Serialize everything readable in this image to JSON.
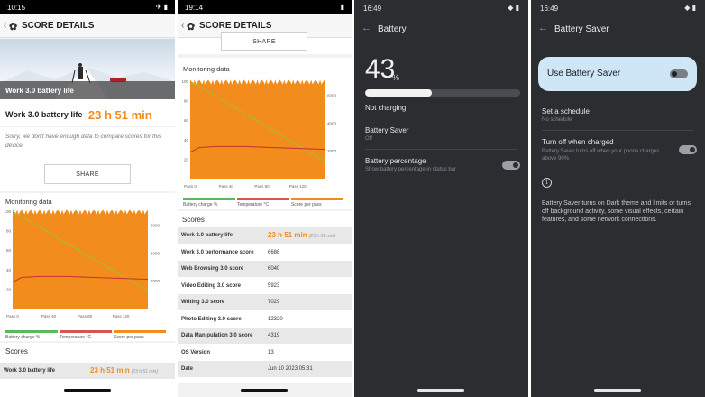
{
  "phone1": {
    "status": {
      "time": "10:15",
      "icons": "✈ ▮"
    },
    "header_title": "SCORE DETAILS",
    "hero_caption": "Work 3.0 battery life",
    "life_label": "Work 3.0 battery life",
    "life_value": "23 h 51 min",
    "sorry_text": "Sorry, we don't have enough data to compare scores for this device.",
    "share_label": "SHARE",
    "monitoring_title": "Monitoring data",
    "scores_title": "Scores",
    "first_score": {
      "label": "Work 3.0 battery life",
      "value": "23 h 51 min",
      "sub": "(23 h 51 min)"
    }
  },
  "phone2": {
    "status": {
      "time": "19:14",
      "icons": "▮"
    },
    "header_title": "SCORE DETAILS",
    "share_label": "SHARE",
    "monitoring_title": "Monitoring data",
    "scores_title": "Scores",
    "scores": [
      {
        "label": "Work 3.0 battery life",
        "value": "23 h 51 min",
        "sub": "(23 h 51 min)"
      },
      {
        "label": "Work 3.0 performance score",
        "value": "6688"
      },
      {
        "label": "Web Browsing 3.0 score",
        "value": "6040"
      },
      {
        "label": "Video Editing 3.0 score",
        "value": "5923"
      },
      {
        "label": "Writing 3.0 score",
        "value": "7029"
      },
      {
        "label": "Photo Editing 3.0 score",
        "value": "12320"
      },
      {
        "label": "Data Manipulation 3.0 score",
        "value": "4319"
      },
      {
        "label": "OS Version",
        "value": "13"
      },
      {
        "label": "Date",
        "value": "Jun 10 2023 05:31"
      }
    ]
  },
  "chart_data": {
    "type": "line",
    "x_tick_labels": [
      "Pass 0",
      "Pass 40",
      "Pass 80",
      "Pass 120"
    ],
    "left_axis_ticks": [
      "100",
      "80",
      "60",
      "40",
      "20"
    ],
    "right_axis_ticks": [
      "6000",
      "4000",
      "2000"
    ],
    "ylim_left": [
      0,
      100
    ],
    "ylim_right": [
      0,
      7000
    ],
    "legend": [
      "Battery charge %",
      "Temperature °C",
      "Score per pass"
    ],
    "legend_colors": [
      "#5cb85c",
      "#d9534f",
      "#f28c1c"
    ],
    "series": [
      {
        "name": "Battery charge %",
        "x": [
          0,
          150
        ],
        "values": [
          100,
          18
        ]
      },
      {
        "name": "Temperature °C",
        "x": [
          0,
          10,
          30,
          60,
          90,
          120,
          150
        ],
        "values": [
          27,
          32,
          33,
          33,
          32,
          31,
          30
        ]
      },
      {
        "name": "Score per pass",
        "x": [
          0,
          150
        ],
        "values": [
          6900,
          6900
        ]
      }
    ]
  },
  "phone3": {
    "status": {
      "time": "16:49",
      "icons": "◆ ▮"
    },
    "title": "Battery",
    "percent": "43",
    "percent_symbol": "%",
    "battery_level": 0.43,
    "charging_status": "Not charging",
    "saver_label": "Battery Saver",
    "saver_sub": "Off",
    "percentage_label": "Battery percentage",
    "percentage_sub": "Show battery percentage in status bar"
  },
  "phone4": {
    "status": {
      "time": "16:49",
      "icons": "◆ ▮"
    },
    "title": "Battery Saver",
    "use_label": "Use Battery Saver",
    "schedule_label": "Set a schedule",
    "schedule_sub": "No schedule",
    "turnoff_label": "Turn off when charged",
    "turnoff_sub": "Battery Saver turns off when your phone charges above 90%",
    "info_text": "Battery Saver turns on Dark theme and limits or turns off background activity, some visual effects, certain features, and some network connections."
  },
  "colors": {
    "accent_orange": "#f28c1c",
    "dark_bg": "#2b2d31",
    "dark_accent": "#8f8cf5",
    "use_card": "#cfe6f7"
  },
  "icons": {
    "back": "chevron-left-icon",
    "gear": "gear-icon",
    "info": "info-icon",
    "wifi": "wifi-icon",
    "battery": "battery-icon",
    "airplane": "airplane-icon"
  }
}
